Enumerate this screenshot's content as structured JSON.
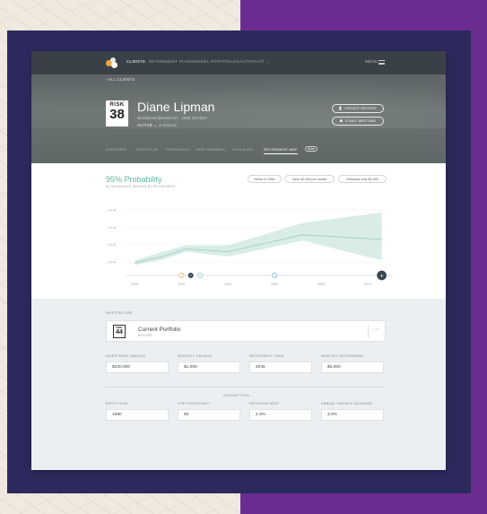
{
  "nav": {
    "items": [
      "CLIENTS",
      "RETIREMENT PLANS",
      "MODEL PORTFOLIOS",
      "AUTOPILOT ⌄"
    ],
    "menu": "MENU"
  },
  "header": {
    "back": "‹ ALL CLIENTS",
    "risk_word": "RISK",
    "risk_number": "38",
    "name": "Diane Lipman",
    "contact": "dianelipman@email.com · (469) 123-4567",
    "status": "ACTIVE ⌄",
    "remove": "⊗ Remove",
    "buttons": {
      "report": "CREATE REPORT",
      "meeting": "START MEETING"
    }
  },
  "tabs": [
    "OVERVIEW",
    "PORTFOLIO",
    "PROPOSALS",
    "RISK NUMBERS",
    "CHECK-INS",
    "RETIREMENT MAP",
    "More"
  ],
  "probability": {
    "title": "95% Probability",
    "subtitle": "$2.3M SAVINGS NEEDED BY RETIREMENT",
    "pills": [
      "Retire in 2050",
      "Save $2,000 per month",
      "Withdraw only $4,000"
    ]
  },
  "chart_data": {
    "type": "area",
    "ylabels": [
      "3.0 M",
      "2.5 M",
      "2.0 M",
      "1.5 M"
    ],
    "xlabels": [
      "2020",
      "2030",
      "2040",
      "2050",
      "2060",
      "2070"
    ],
    "x": [
      2020,
      2026,
      2031,
      2040,
      2056,
      2073
    ],
    "median": [
      1.48,
      1.66,
      1.88,
      1.8,
      2.28,
      2.15
    ],
    "upper": [
      1.55,
      1.8,
      1.98,
      1.98,
      2.62,
      2.92
    ],
    "lower": [
      1.42,
      1.57,
      1.8,
      1.66,
      2.12,
      1.55
    ],
    "ylim": [
      1.3,
      3.2
    ],
    "xlim": [
      2018,
      2075
    ],
    "markers": [
      {
        "x": 2030,
        "label": "1",
        "color": "#f2a94a"
      },
      {
        "x": 2032,
        "label": "2",
        "color": "#3a4450"
      },
      {
        "x": 2034,
        "label": "3",
        "color": "#8ec7c1"
      },
      {
        "x": 2050,
        "label": "4",
        "color": "#6ba9d6"
      },
      {
        "x": 2073,
        "label": "+",
        "color": "#3a4450"
      }
    ],
    "colors": {
      "line": "#9ccac0",
      "band": "#d9ece8",
      "axis": "#d6dcde"
    }
  },
  "portfolio": {
    "section_label": "INVESTED USE",
    "risk_word": "RISK",
    "risk_number": "44",
    "name": "Current Portfolio",
    "value": "$100,000",
    "more": "···"
  },
  "fields_top": [
    {
      "label": "INVESTMENT AMOUNT",
      "value": "$100,000"
    },
    {
      "label": "MONTHLY SAVINGS",
      "value": "$1,000"
    },
    {
      "label": "RETIREMENT YEAR",
      "value": "2045"
    },
    {
      "label": "MONTHLY WITHDRAWAL",
      "value": "$5,000"
    }
  ],
  "assumptions": "ASSUMPTIONS ⌄",
  "fields_bottom": [
    {
      "label": "BIRTH YEAR",
      "value": "1990"
    },
    {
      "label": "LIFE EXPECTANCY",
      "value": "90"
    },
    {
      "label": "INFLATION RATE",
      "value": "2.3%"
    },
    {
      "label": "ANNUAL SAVINGS INCREASE",
      "value": "3.0%"
    }
  ]
}
